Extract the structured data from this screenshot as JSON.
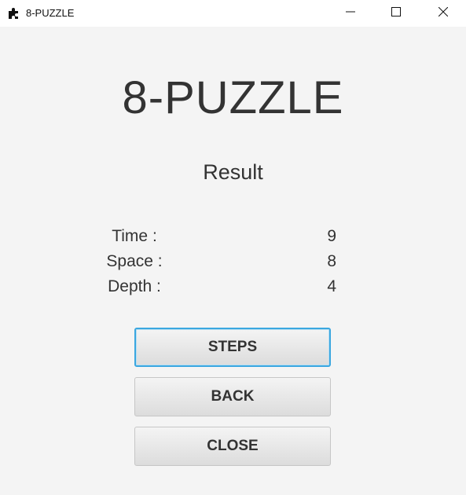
{
  "window": {
    "title": "8-PUZZLE",
    "icon": "puzzle-piece-icon",
    "controls": [
      "minimize-icon",
      "maximize-icon",
      "close-icon"
    ]
  },
  "main": {
    "heading": "8-PUZZLE",
    "subheading": "Result",
    "stats": [
      {
        "label": "Time :",
        "value": "9"
      },
      {
        "label": "Space :",
        "value": "8"
      },
      {
        "label": "Depth :",
        "value": "4"
      }
    ],
    "buttons": {
      "steps": "STEPS",
      "back": "BACK",
      "close": "CLOSE"
    }
  },
  "colors": {
    "background": "#f4f4f4",
    "text": "#333333",
    "focus_border": "#3ba7e0"
  }
}
